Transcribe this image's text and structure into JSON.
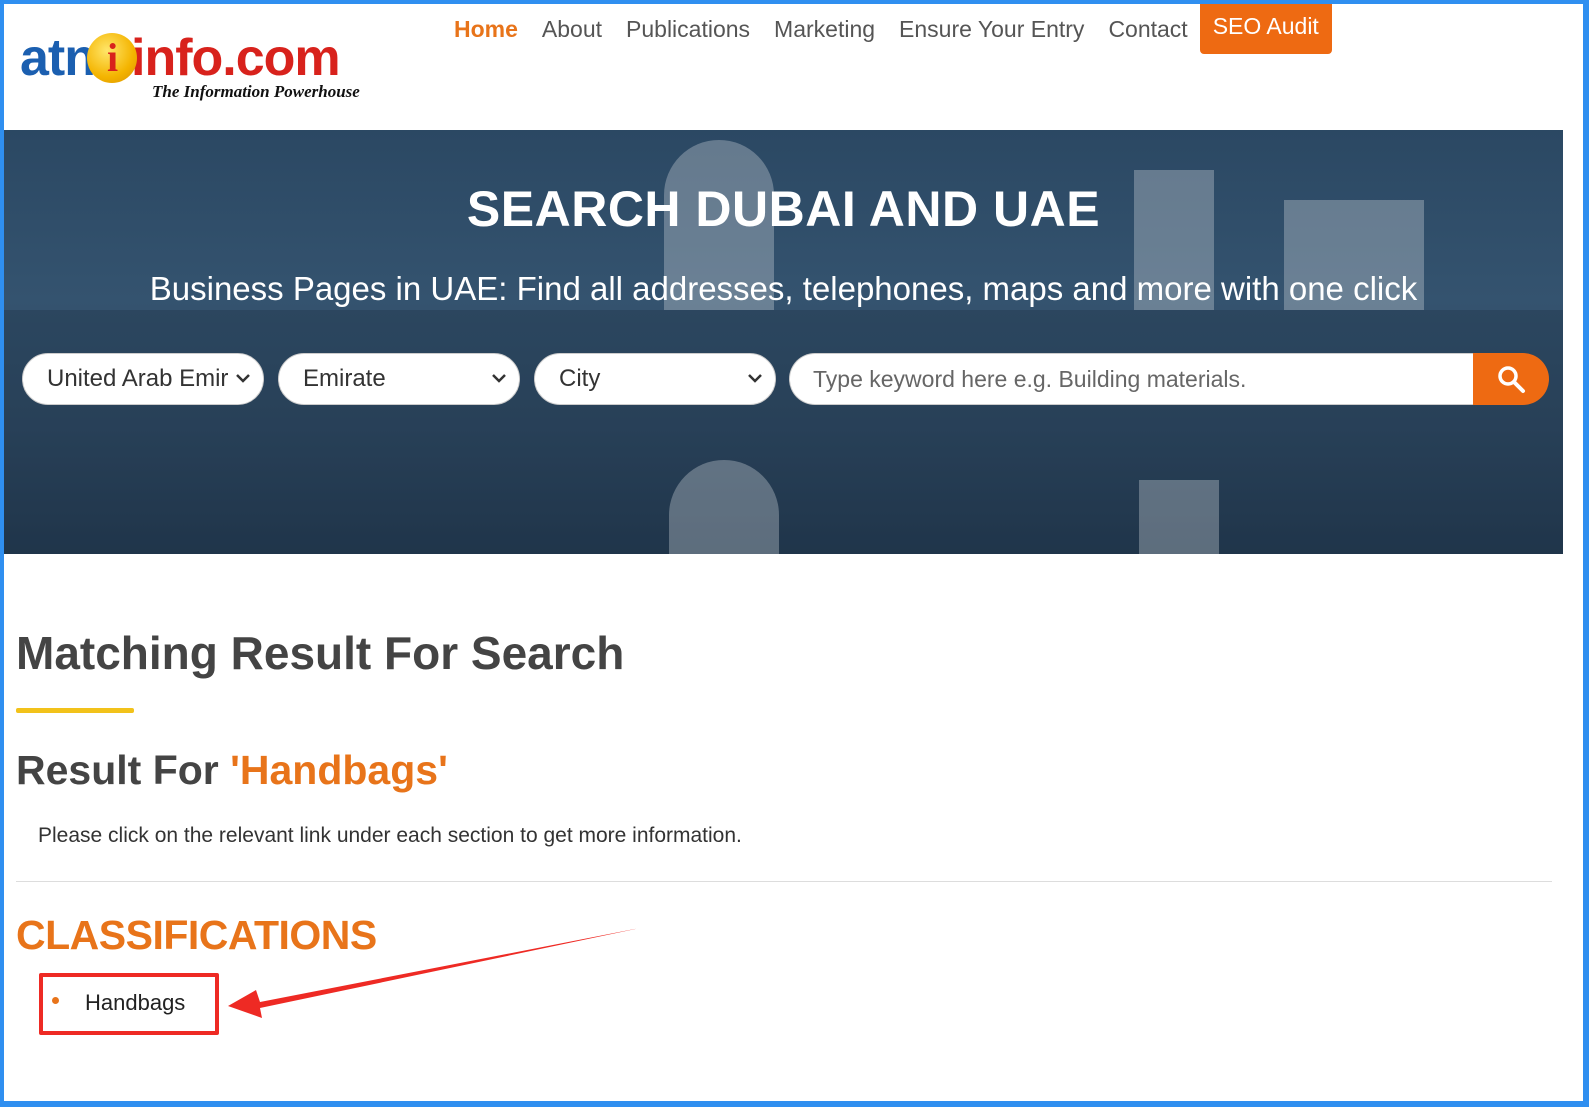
{
  "brand": {
    "logo_text_blue": "atn",
    "logo_circle": "i",
    "logo_text_red": "info.com",
    "tagline": "The Information Powerhouse"
  },
  "nav": {
    "items": [
      {
        "label": "Home",
        "active": true
      },
      {
        "label": "About"
      },
      {
        "label": "Publications"
      },
      {
        "label": "Marketing"
      },
      {
        "label": "Ensure Your Entry"
      },
      {
        "label": "Contact"
      }
    ],
    "cta_label": "SEO Audit"
  },
  "hero": {
    "title": "SEARCH DUBAI AND UAE",
    "subtitle": "Business Pages in UAE: Find all addresses, telephones, maps and more with one click",
    "country_select": "United Arab Emir",
    "emirate_select": "Emirate",
    "city_select": "City",
    "keyword_placeholder": "Type keyword here e.g. Building materials."
  },
  "results": {
    "heading": "Matching Result For Search",
    "result_prefix": "Result For ",
    "result_term": "'Handbags'",
    "instructions": "Please click on the relevant link under each section to get more information.",
    "classifications_heading": "CLASSIFICATIONS",
    "classification_items": [
      "Handbags"
    ]
  },
  "colors": {
    "accent_orange": "#ee6a12",
    "frame_blue": "#2f8ff0",
    "annotation_red": "#ee2a24",
    "rule_yellow": "#f2c21a"
  }
}
